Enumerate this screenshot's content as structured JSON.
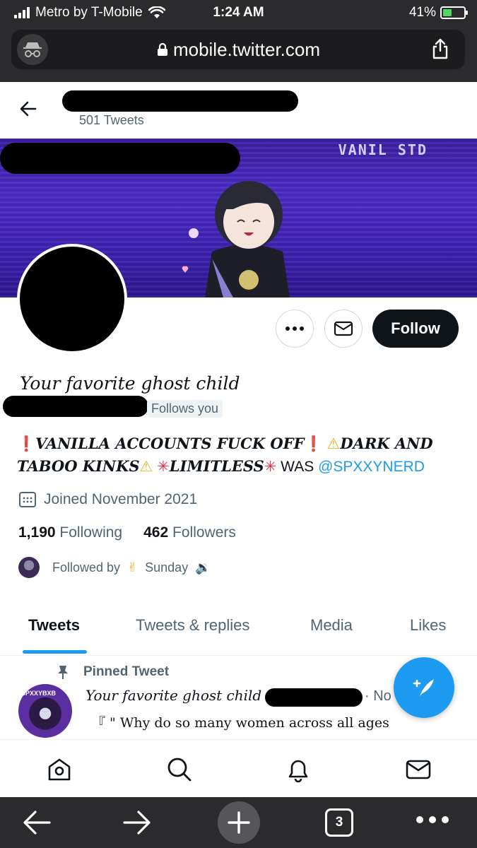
{
  "status_bar": {
    "carrier": "Metro by T-Mobile",
    "time": "1:24 AM",
    "battery": "41%",
    "battery_level": 0.41
  },
  "browser": {
    "url": "mobile.twitter.com",
    "tab_count": "3",
    "icons": [
      "incognito-icon",
      "lock-icon",
      "share-icon",
      "back-arrow-icon",
      "forward-arrow-icon",
      "plus-icon",
      "more-icon"
    ]
  },
  "profile": {
    "tweet_count": "501 Tweets",
    "banner_text": "VANIL  STD",
    "display_name": "Your favorite ghost child",
    "follows_you": "Follows you",
    "bio": {
      "part1": "VANILLA ACCOUNTS FUCK OFF",
      "part2": "DARK AND TABOO KINKS",
      "part3": "LIMITLESS",
      "was": "WAS",
      "handle_link": "@SPXXYNERD"
    },
    "joined": "Joined November 2021",
    "following_count": "1,190",
    "following_label": "Following",
    "followers_count": "462",
    "followers_label": "Followers",
    "followed_by_label": "Followed by",
    "followed_by_name": "Sunday"
  },
  "actions": {
    "follow_label": "Follow"
  },
  "tabs": [
    {
      "label": "Tweets",
      "active": true
    },
    {
      "label": "Tweets & replies",
      "active": false
    },
    {
      "label": "Media",
      "active": false
    },
    {
      "label": "Likes",
      "active": false
    }
  ],
  "pinned_tweet": {
    "label": "Pinned Tweet",
    "author": "Your favorite ghost child",
    "date": "· No",
    "avatar_tag": "SPXXYBXB",
    "text": "『 \" Why do so many women across all ages"
  },
  "bottom_nav": [
    "home-icon",
    "search-icon",
    "notifications-icon",
    "messages-icon"
  ],
  "colors": {
    "accent": "#1d9bf0",
    "banner": "#4b2bc4",
    "follow_button": "#0f1419"
  }
}
